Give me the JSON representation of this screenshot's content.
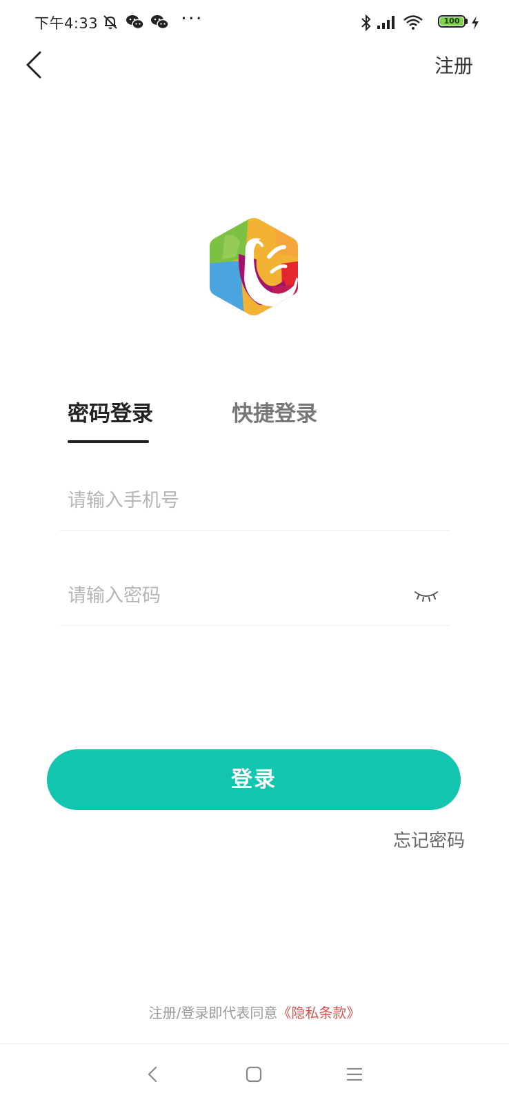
{
  "status_bar": {
    "time": "下午4:33",
    "more": "···",
    "battery": "100",
    "icons": [
      "mute-bell-icon",
      "wechat-icon",
      "wechat-icon",
      "bluetooth-icon",
      "signal-icon",
      "wifi-icon",
      "charging-icon"
    ]
  },
  "header": {
    "back_icon": "chevron-left-icon",
    "register_label": "注册"
  },
  "logo": {
    "icon": "app-logo"
  },
  "tabs": [
    {
      "label": "密码登录",
      "active": true
    },
    {
      "label": "快捷登录",
      "active": false
    }
  ],
  "form": {
    "phone_placeholder": "请输入手机号",
    "password_placeholder": "请输入密码",
    "eye_icon": "eye-closed-icon"
  },
  "login_button": {
    "label": "登录"
  },
  "forgot_password": "忘记密码",
  "agreement": {
    "text": "注册/登录即代表同意",
    "link": "《隐私条款》"
  },
  "nav_bar": {
    "icons": [
      "nav-back-icon",
      "nav-home-icon",
      "nav-menu-icon"
    ]
  },
  "colors": {
    "accent": "#13c5ae",
    "link_red": "#d9534f",
    "battery_green": "#7fd34b"
  }
}
